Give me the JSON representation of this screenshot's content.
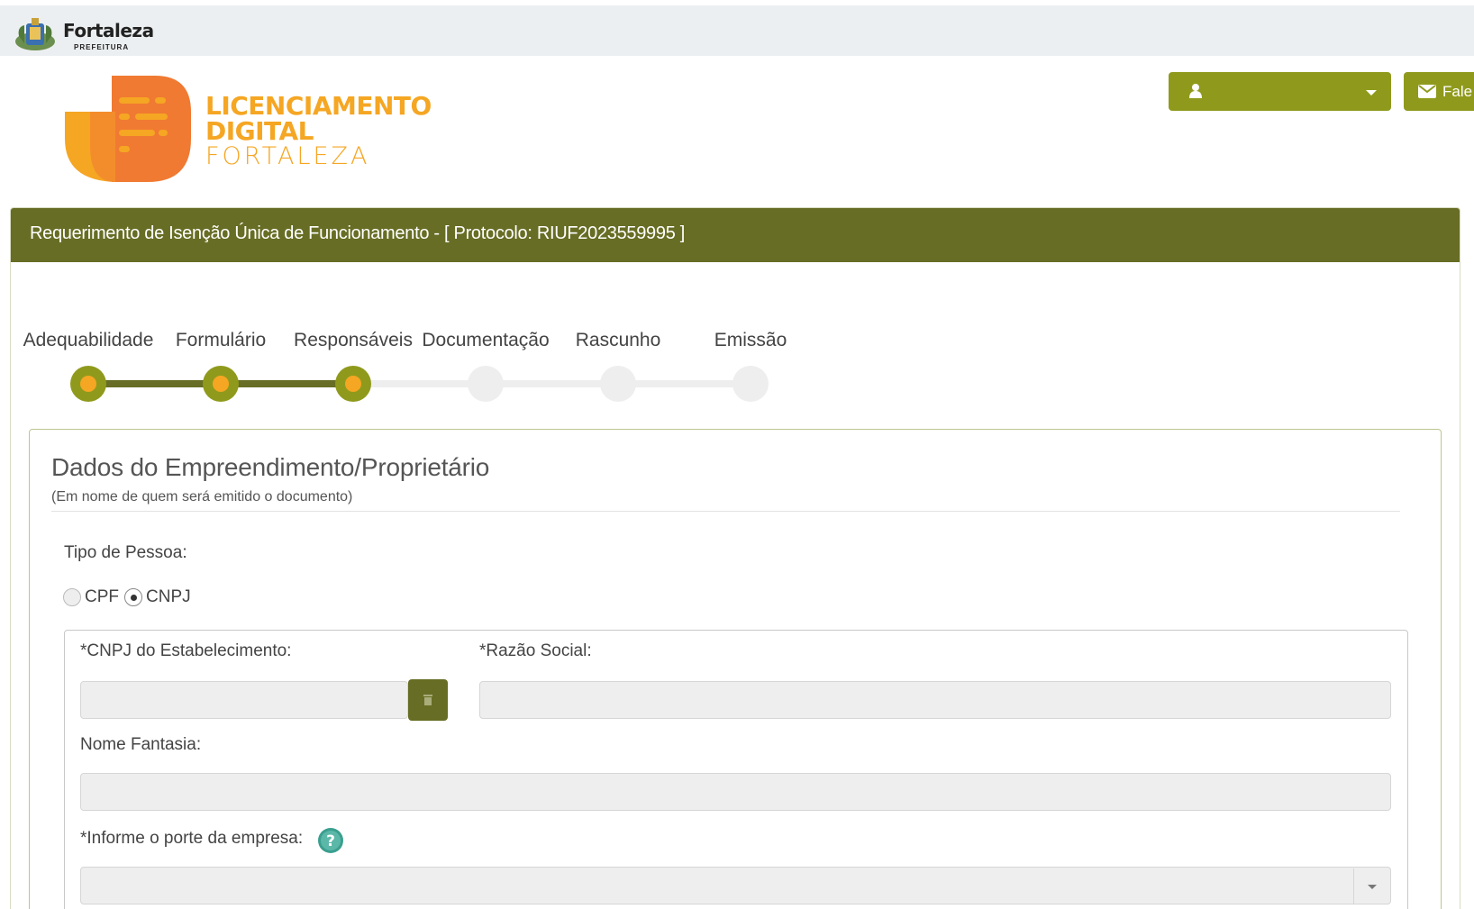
{
  "header": {
    "brand_name": "Fortaleza",
    "brand_sub": "PREFEITURA"
  },
  "logo": {
    "line1": "LICENCIAMENTO",
    "line2": "DIGITAL",
    "line3": "FORTALEZA"
  },
  "actions": {
    "user_name": "",
    "contact_label": "Fale"
  },
  "panel": {
    "title": "Requerimento de Isenção Única de Funcionamento - [ Protocolo: RIUF2023559995 ]"
  },
  "steps": [
    {
      "label": "Adequabilidade",
      "active": true
    },
    {
      "label": "Formulário",
      "active": true
    },
    {
      "label": "Responsáveis",
      "active": true
    },
    {
      "label": "Documentação",
      "active": false
    },
    {
      "label": "Rascunho",
      "active": false
    },
    {
      "label": "Emissão",
      "active": false
    }
  ],
  "card": {
    "title": "Dados do Empreendimento/Proprietário",
    "subtitle": "(Em nome de quem será emitido o documento)",
    "tipo_label": "Tipo de Pessoa:",
    "options": [
      "CPF",
      "CNPJ"
    ],
    "selected_option": "CNPJ"
  },
  "fields": {
    "cnpj_label": "*CNPJ do Estabelecimento:",
    "cnpj_value": "",
    "razao_label": "*Razão Social:",
    "razao_value": "",
    "fantasia_label": "Nome Fantasia:",
    "fantasia_value": "",
    "porte_label": "*Informe o porte da empresa:",
    "porte_value": ""
  },
  "colors": {
    "olive_dark": "#676d24",
    "olive": "#8f9a1c",
    "orange": "#f5a623",
    "logo_orange": "#f07a32"
  }
}
